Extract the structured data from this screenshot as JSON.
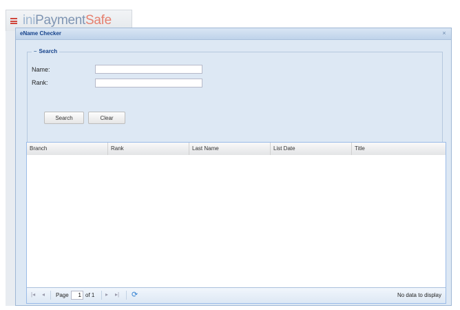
{
  "app": {
    "logo_part1": "ini",
    "logo_part2": "Payment",
    "logo_part3": "Safe"
  },
  "dialog": {
    "title": "eName Checker",
    "close_glyph": "×"
  },
  "search": {
    "legend": "Search",
    "toggle_glyph": "–",
    "name_label": "Name:",
    "rank_label": "Rank:",
    "name_value": "",
    "rank_value": "",
    "search_button": "Search",
    "clear_button": "Clear"
  },
  "grid": {
    "columns": [
      "Branch",
      "Rank",
      "Last Name",
      "List Date",
      "Title"
    ],
    "rows": []
  },
  "pager": {
    "first_glyph": "|◂",
    "prev_glyph": "◂",
    "page_label": "Page",
    "page_value": "1",
    "of_total": "of 1",
    "next_glyph": "▸",
    "last_glyph": "▸|",
    "refresh_glyph": "⟳",
    "empty_message": "No data to display"
  }
}
